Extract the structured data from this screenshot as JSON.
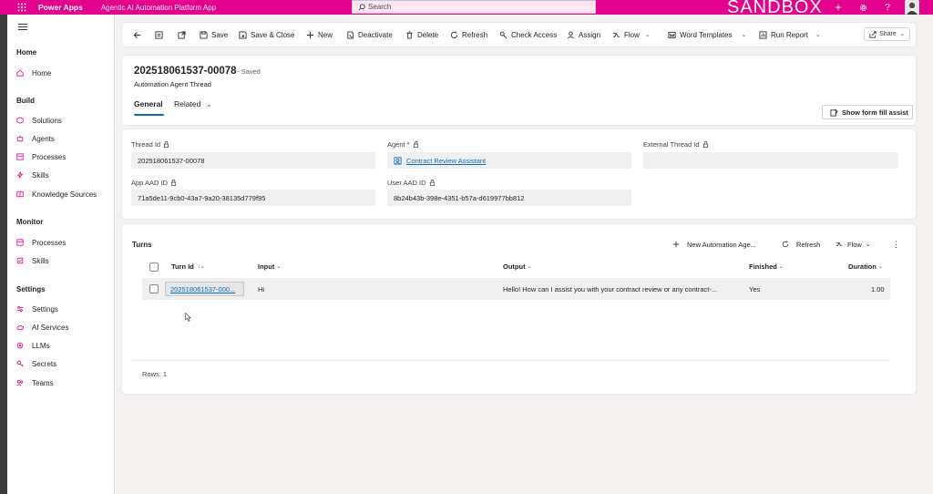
{
  "topbar": {
    "brand": "Power Apps",
    "app_name": "Agentic AI Automation Platform App",
    "search_placeholder": "Search",
    "environment_label": "SANDBOX",
    "accent_color": "#e3008c"
  },
  "sidebar": {
    "sections": [
      {
        "title": "Home",
        "items": [
          {
            "label": "Home",
            "icon": "home-icon"
          }
        ]
      },
      {
        "title": "Build",
        "items": [
          {
            "label": "Solutions",
            "icon": "solutions-icon"
          },
          {
            "label": "Agents",
            "icon": "agents-icon"
          },
          {
            "label": "Processes",
            "icon": "processes-icon"
          },
          {
            "label": "Skills",
            "icon": "skills-icon"
          },
          {
            "label": "Knowledge Sources",
            "icon": "knowledge-icon"
          }
        ]
      },
      {
        "title": "Monitor",
        "items": [
          {
            "label": "Processes",
            "icon": "processes-icon"
          },
          {
            "label": "Skills",
            "icon": "skills-icon"
          }
        ]
      },
      {
        "title": "Settings",
        "items": [
          {
            "label": "Settings",
            "icon": "settings-icon"
          },
          {
            "label": "AI Services",
            "icon": "cloud-icon"
          },
          {
            "label": "LLMs",
            "icon": "llm-icon"
          },
          {
            "label": "Secrets",
            "icon": "key-icon"
          },
          {
            "label": "Teams",
            "icon": "teams-icon"
          }
        ]
      }
    ]
  },
  "commandbar": {
    "save": "Save",
    "save_close": "Save & Close",
    "new": "New",
    "deactivate": "Deactivate",
    "delete": "Delete",
    "refresh": "Refresh",
    "check_access": "Check Access",
    "assign": "Assign",
    "flow": "Flow",
    "word_templates": "Word Templates",
    "run_report": "Run Report",
    "share": "Share"
  },
  "record": {
    "title": "202518061537-00078",
    "saved_status": "- Saved",
    "entity": "Automation Agent Thread",
    "tabs": [
      "General",
      "Related"
    ],
    "form_fill_assist": "Show form fill assist"
  },
  "fields": {
    "thread_id_label": "Thread Id",
    "thread_id_value": "202518061537-00078",
    "agent_label": "Agent *",
    "agent_value": "Contract Review Assistant",
    "external_thread_label": "External Thread Id",
    "external_thread_value": "",
    "app_aad_label": "App AAD ID",
    "app_aad_value": "71a5de11-9cb0-43a7-9a20-38135d779f95",
    "user_aad_label": "User AAD ID",
    "user_aad_value": "8b24b43b-398e-4351-b57a-d619977bb812"
  },
  "turns": {
    "title": "Turns",
    "new_label": "New Automation Age...",
    "refresh_label": "Refresh",
    "flow_label": "Flow",
    "columns": [
      "Turn Id",
      "Input",
      "Output",
      "Finished",
      "Duration"
    ],
    "rows": [
      {
        "turn_id": "202518061537-000...",
        "input": "Hi",
        "output": "Hello! How can I assist you with your contract review or any contract-...",
        "finished": "Yes",
        "duration": "1.00"
      }
    ],
    "rows_count": "Rows: 1"
  }
}
